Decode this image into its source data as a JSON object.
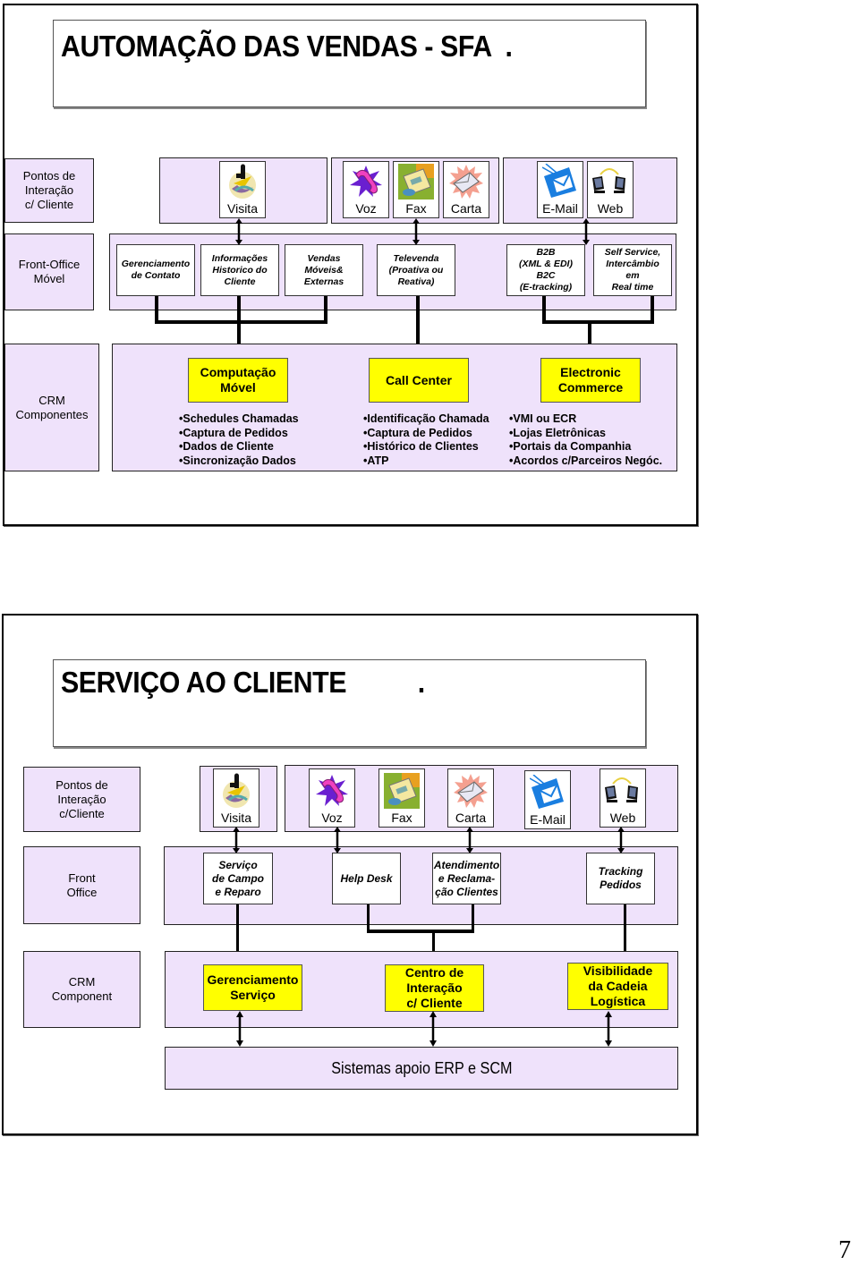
{
  "page_number": "7",
  "slides": [
    {
      "title": "AUTOMAÇÃO DAS VENDAS - SFA  .",
      "rows": {
        "interaction": "Pontos de\nInteração\nc/ Cliente",
        "front_office": "Front-Office\nMóvel",
        "crm": "CRM\nComponentes"
      },
      "channels": [
        {
          "label": "Visita",
          "icon": "businessman-icon"
        },
        {
          "label": "Voz",
          "icon": "telephone-icon"
        },
        {
          "label": "Fax",
          "icon": "fax-icon"
        },
        {
          "label": "Carta",
          "icon": "letter-icon"
        },
        {
          "label": "E-Mail",
          "icon": "email-icon"
        },
        {
          "label": "Web",
          "icon": "computers-icon"
        }
      ],
      "front_office_boxes": [
        "Gerenciamento\nde Contato",
        "Informações\nHistorico do\nCliente",
        "Vendas\nMóveis&\nExternas",
        "Televenda\n(Proativa ou\nReativa)",
        "B2B\n(XML & EDI)\nB2C\n(E-tracking)",
        "Self Service,\nIntercâmbio\nem\nReal time"
      ],
      "components": [
        {
          "name": "Computação\nMóvel",
          "items": [
            "Schedules Chamadas",
            "Captura de Pedidos",
            "Dados de Cliente",
            "Sincronização Dados"
          ]
        },
        {
          "name": "Call Center",
          "items": [
            "Identificação Chamada",
            "Captura de Pedidos",
            "Histórico de Clientes",
            "ATP"
          ]
        },
        {
          "name": "Electronic\nCommerce",
          "items": [
            "VMI ou ECR",
            "Lojas Eletrônicas",
            "Portais da Companhia",
            "Acordos c/Parceiros Negóc."
          ]
        }
      ]
    },
    {
      "title": "SERVIÇO AO CLIENTE          .",
      "rows": {
        "interaction": "Pontos de\nInteração\nc/Cliente",
        "front_office": "Front\nOffice",
        "crm": "CRM\nComponent"
      },
      "channels": [
        {
          "label": "Visita",
          "icon": "businessman-icon"
        },
        {
          "label": "Voz",
          "icon": "telephone-icon"
        },
        {
          "label": "Fax",
          "icon": "fax-icon"
        },
        {
          "label": "Carta",
          "icon": "letter-icon"
        },
        {
          "label": "E-Mail",
          "icon": "email-icon"
        },
        {
          "label": "Web",
          "icon": "computers-icon"
        }
      ],
      "front_office_boxes": [
        "Serviço\nde Campo\ne Reparo",
        "Help Desk",
        "Atendimento\ne Reclama-\nção Clientes",
        "Tracking\nPedidos"
      ],
      "components": [
        {
          "name": "Gerenciamento\nServiço"
        },
        {
          "name": "Centro de\nInteração\nc/ Cliente"
        },
        {
          "name": "Visibilidade\nda Cadeia\nLogística"
        }
      ],
      "backend": "Sistemas apoio ERP e SCM"
    }
  ]
}
